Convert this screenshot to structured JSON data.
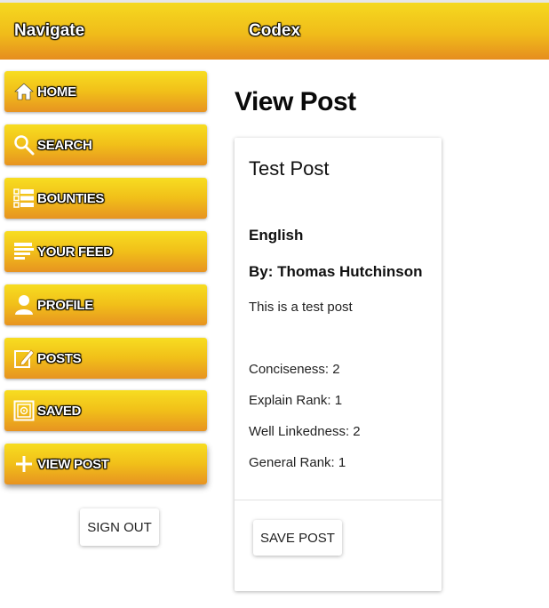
{
  "header": {
    "nav_title": "Navigate",
    "app_title": "Codex"
  },
  "sidebar": {
    "items": [
      {
        "label": "HOME",
        "icon": "home-icon"
      },
      {
        "label": "SEARCH",
        "icon": "search-icon"
      },
      {
        "label": "BOUNTIES",
        "icon": "list-icon"
      },
      {
        "label": "YOUR FEED",
        "icon": "feed-icon"
      },
      {
        "label": "PROFILE",
        "icon": "person-icon"
      },
      {
        "label": "POSTS",
        "icon": "edit-icon"
      },
      {
        "label": "SAVED",
        "icon": "safe-icon"
      },
      {
        "label": "VIEW POST",
        "icon": "plus-icon",
        "active": true
      }
    ],
    "signout_label": "SIGN OUT"
  },
  "main": {
    "page_title": "View Post",
    "post": {
      "title": "Test Post",
      "language": "English",
      "author": "By: Thomas Hutchinson",
      "body": "This is a test post",
      "metrics": [
        "Conciseness: 2",
        "Explain Rank: 1",
        "Well Linkedness: 2",
        "General Rank: 1"
      ],
      "save_label": "SAVE POST"
    }
  },
  "colors": {
    "accent_top": "#f5d91f",
    "accent_bottom": "#e68d1f"
  }
}
